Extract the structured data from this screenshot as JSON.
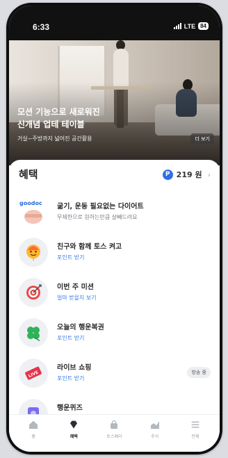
{
  "status_bar": {
    "time": "6:33",
    "network": "LTE",
    "battery": "84"
  },
  "hero": {
    "title_line1": "모션 기능으로 새로워진",
    "title_line2": "신개념 업테 테이블",
    "subtitle": "거실~주방까지 넓어진 공간활용",
    "more_label": "더 보기"
  },
  "benefits": {
    "title": "혜택",
    "points_badge": "P",
    "points_value": "219 원",
    "items": [
      {
        "title": "굶기, 운동 필요없는 다이어트",
        "subtitle": "무제한으로 원하는만큼 살빼드려요",
        "icon": "goodoc-logo",
        "logo_text": "goodoc"
      },
      {
        "title": "친구와 함께 토스 켜고",
        "subtitle": "포인트 받기",
        "icon": "smiley-balloon-icon"
      },
      {
        "title": "이번 주 미션",
        "subtitle": "얼마 받을지 보기",
        "icon": "target-icon"
      },
      {
        "title": "오늘의 행운복권",
        "subtitle": "포인트 받기",
        "icon": "clover-icon"
      },
      {
        "title": "라이브 쇼핑",
        "subtitle": "포인트 받기",
        "icon": "live-ticket-icon",
        "badge": "방송 중"
      },
      {
        "title": "행운퀴즈",
        "subtitle": "",
        "icon": "quiz-icon"
      }
    ]
  },
  "tabbar": {
    "active": "benefits",
    "tabs": [
      {
        "key": "home",
        "label": "홈",
        "icon": "home-icon"
      },
      {
        "key": "benefits",
        "label": "혜택",
        "icon": "diamond-icon"
      },
      {
        "key": "tosspay",
        "label": "토스페이",
        "icon": "bag-icon"
      },
      {
        "key": "stock",
        "label": "주식",
        "icon": "chart-icon"
      },
      {
        "key": "all",
        "label": "전체",
        "icon": "menu-icon"
      }
    ]
  },
  "colors": {
    "accent_blue": "#3d7ee8",
    "points_blue": "#2f6fe4",
    "status_bar": "#111111"
  }
}
